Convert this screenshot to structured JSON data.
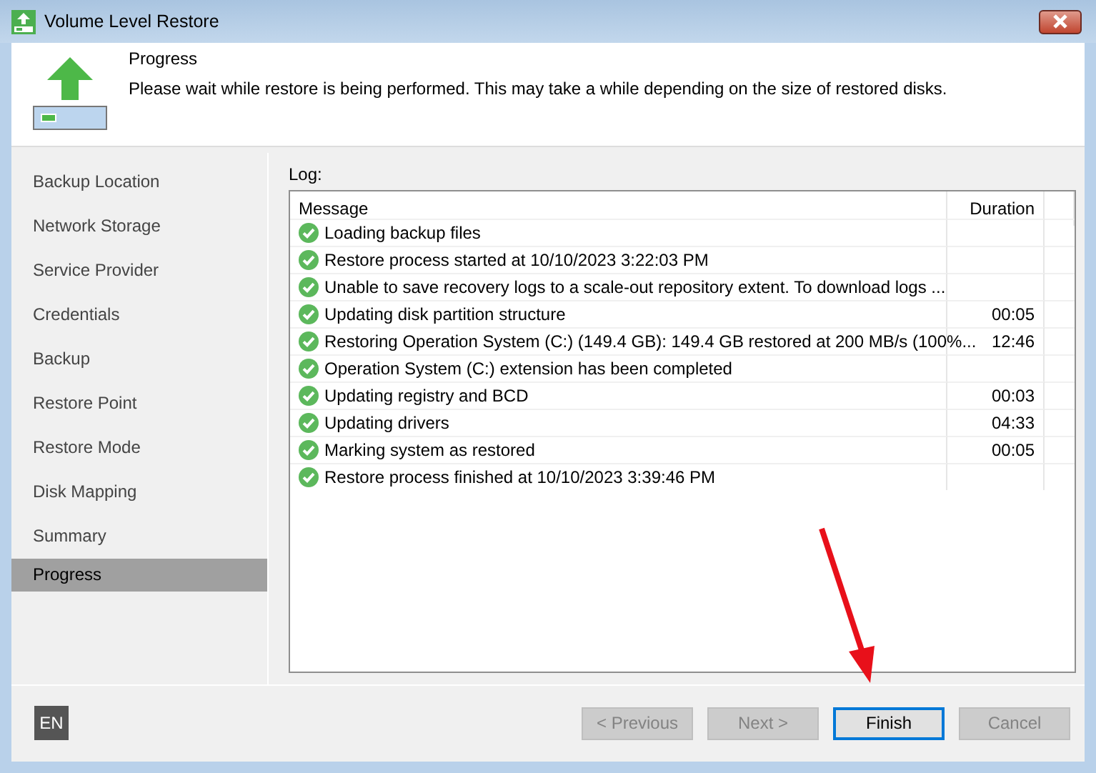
{
  "window": {
    "title": "Volume Level Restore"
  },
  "header": {
    "title": "Progress",
    "description": "Please wait while restore is being performed. This may take a while depending on the size of restored disks."
  },
  "steps": [
    {
      "label": "Backup Location",
      "selected": false
    },
    {
      "label": "Network Storage",
      "selected": false
    },
    {
      "label": "Service Provider",
      "selected": false
    },
    {
      "label": "Credentials",
      "selected": false
    },
    {
      "label": "Backup",
      "selected": false
    },
    {
      "label": "Restore Point",
      "selected": false
    },
    {
      "label": "Restore Mode",
      "selected": false
    },
    {
      "label": "Disk Mapping",
      "selected": false
    },
    {
      "label": "Summary",
      "selected": false
    },
    {
      "label": "Progress",
      "selected": true
    }
  ],
  "log": {
    "label": "Log:",
    "columns": [
      "Message",
      "Duration"
    ],
    "rows": [
      {
        "succeeded": true,
        "message": "Loading backup files"
      },
      {
        "succeeded": true,
        "message": "Restore process started at 10/10/2023 3:22:03 PM"
      },
      {
        "succeeded": true,
        "message": "Unable to save recovery logs to a scale-out repository extent. To download logs ..."
      },
      {
        "succeeded": true,
        "message": "Updating disk partition structure",
        "duration": "00:05"
      },
      {
        "succeeded": true,
        "message": "Restoring Operation System (C:) (149.4 GB): 149.4 GB restored at 200 MB/s (100%...",
        "duration": "12:46"
      },
      {
        "succeeded": true,
        "message": "Operation System (C:) extension has been completed"
      },
      {
        "succeeded": true,
        "message": "Updating registry and BCD",
        "duration": "00:03"
      },
      {
        "succeeded": true,
        "message": "Updating drivers",
        "duration": "04:33"
      },
      {
        "succeeded": true,
        "message": "Marking system as restored",
        "duration": "00:05"
      },
      {
        "succeeded": true,
        "message": "Restore process finished at 10/10/2023 3:39:46 PM"
      }
    ]
  },
  "language": "EN",
  "buttons": [
    {
      "label": "< Previous",
      "disabled": true,
      "default": false
    },
    {
      "label": "Next >",
      "disabled": true,
      "default": false
    },
    {
      "label": "Finish",
      "disabled": false,
      "default": true
    },
    {
      "label": "Cancel",
      "disabled": true,
      "default": false
    }
  ]
}
